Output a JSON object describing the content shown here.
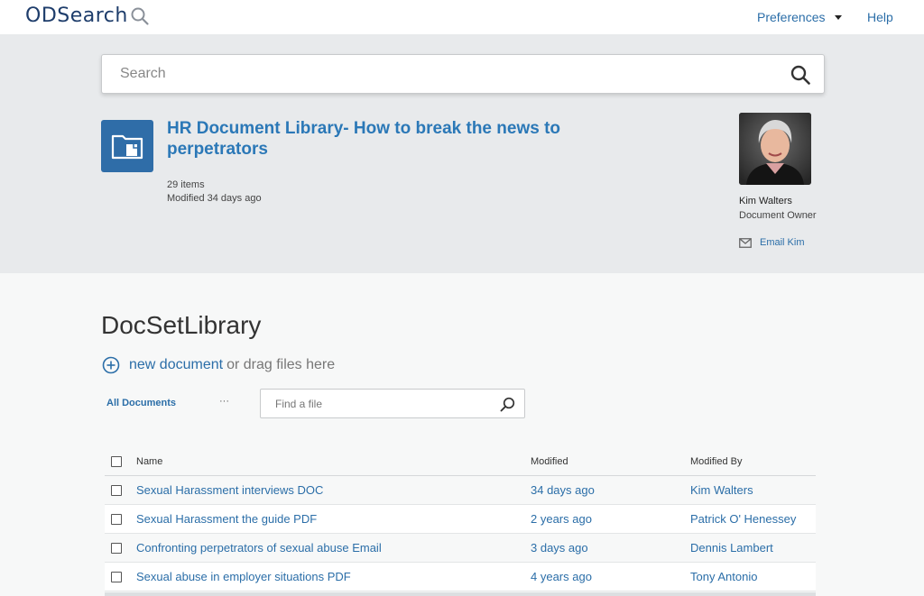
{
  "header": {
    "logo_text": "ODSearch",
    "logo_icon": "search-icon",
    "preferences_label": "Preferences",
    "help_label": "Help"
  },
  "search": {
    "placeholder": "Search",
    "icon": "search-icon"
  },
  "library": {
    "icon": "folder-icon",
    "title": "HR Document Library- How to break the news to perpetrators",
    "items_count": "29 items",
    "modified": "Modified 34 days ago"
  },
  "owner": {
    "name": "Kim Walters",
    "role": "Document Owner",
    "email_label": "Email Kim",
    "email_icon": "mail-icon"
  },
  "doclib": {
    "title": "DocSetLibrary",
    "new_document_label": "new document",
    "drag_text": "or drag files here",
    "view_label": "All Documents",
    "more_label": "···",
    "find_placeholder": "Find a file"
  },
  "table": {
    "columns": [
      "Name",
      "Modified",
      "Modified By"
    ],
    "rows": [
      {
        "name": "Sexual Harassment interviews DOC",
        "modified": "34 days ago",
        "modified_by": "Kim Walters"
      },
      {
        "name": "Sexual Harassment the guide PDF",
        "modified": "2 years ago",
        "modified_by": "Patrick O' Henessey"
      },
      {
        "name": "Confronting perpetrators of sexual abuse Email",
        "modified": "3 days ago",
        "modified_by": "Dennis Lambert"
      },
      {
        "name": "Sexual abuse in employer situations PDF",
        "modified": "4 years ago",
        "modified_by": "Tony Antonio"
      }
    ]
  },
  "colors": {
    "brand": "#1e3d6b",
    "link": "#2b6ea8",
    "hero_bg": "#e8eaec",
    "library_tile": "#2f6da8"
  }
}
